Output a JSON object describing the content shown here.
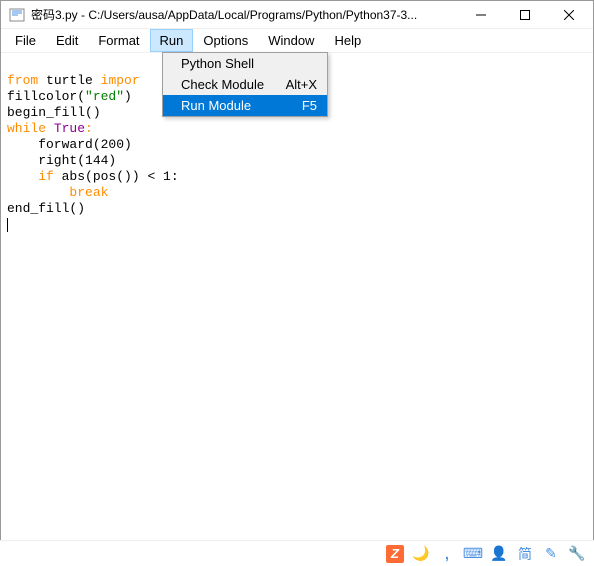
{
  "window": {
    "title": "密码3.py - C:/Users/ausa/AppData/Local/Programs/Python/Python37-3..."
  },
  "menubar": {
    "items": [
      "File",
      "Edit",
      "Format",
      "Run",
      "Options",
      "Window",
      "Help"
    ],
    "open_index": 3
  },
  "dropdown": {
    "items": [
      {
        "label": "Python Shell",
        "shortcut": ""
      },
      {
        "label": "Check Module",
        "shortcut": "Alt+X"
      },
      {
        "label": "Run Module",
        "shortcut": "F5"
      }
    ],
    "highlight_index": 2
  },
  "code": {
    "l1_kw1": "from",
    "l1_txt1": " turtle ",
    "l1_kw2": "impor",
    "l2_txt1": "fillcolor(",
    "l2_str": "\"red\"",
    "l2_txt2": ")",
    "l3": "begin_fill()",
    "l4_kw": "while",
    "l4_txt": " ",
    "l4_val": "True",
    "l4_colon": ":",
    "l5": "    forward(200)",
    "l6": "    right(144)",
    "l7_a": "    ",
    "l7_kw": "if",
    "l7_b": " abs(pos()) < 1:",
    "l8_a": "        ",
    "l8_kw": "break",
    "l9": "end_fill()"
  },
  "tray": {
    "z": "Z"
  }
}
